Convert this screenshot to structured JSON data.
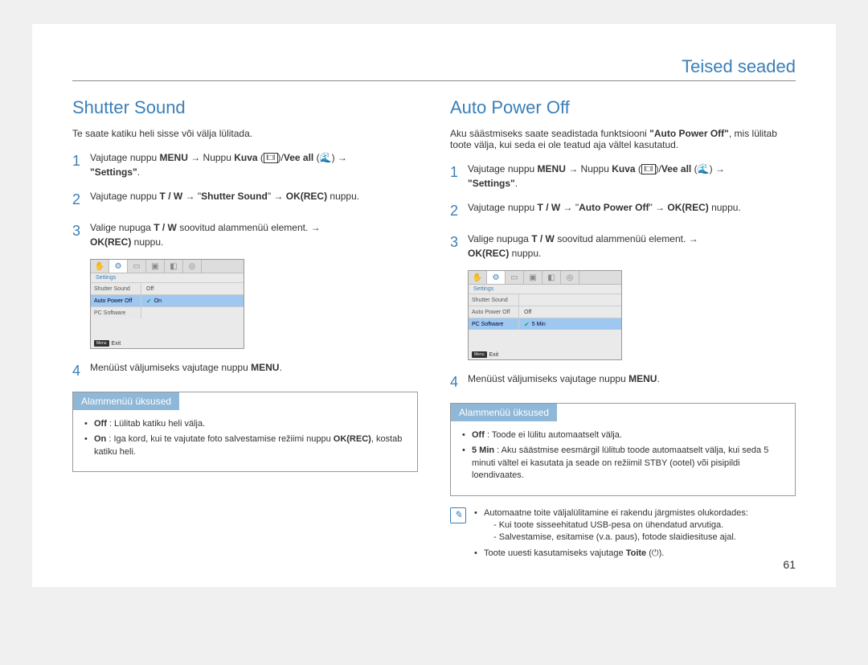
{
  "header": "Teised seaded",
  "page_number": "61",
  "left": {
    "title": "Shutter Sound",
    "intro": "Te saate katiku heli sisse või välja lülitada.",
    "step1_a": "Vajutage nuppu ",
    "step1_menu": "MENU",
    "step1_b": " → Nuppu ",
    "step1_kuva": "Kuva",
    "step1_c": " (",
    "step1_d": ")/",
    "step1_vee": "Vee all",
    "step1_e": " (",
    "step1_f": ") → ",
    "step1_settings": "\"Settings\"",
    "step1_g": ".",
    "step2_a": "Vajutage nuppu ",
    "step2_tw": "T / W",
    "step2_b": " → \"",
    "step2_shutter": "Shutter Sound",
    "step2_c": "\" → ",
    "step2_ok": "OK(REC)",
    "step2_d": " nuppu.",
    "step3_a": "Valige nupuga ",
    "step3_tw": "T / W",
    "step3_b": " soovitud alammenüü element. → ",
    "step3_ok": "OK(REC)",
    "step3_c": " nuppu.",
    "step4_a": "Menüüst väljumiseks vajutage nuppu ",
    "step4_menu": "MENU",
    "step4_b": ".",
    "screen": {
      "settings_label": "Settings",
      "rows": [
        {
          "name": "Shutter Sound",
          "val": "Off",
          "selected": false
        },
        {
          "name": "Auto Power Off",
          "val": "On",
          "selected": true,
          "check": true
        },
        {
          "name": "PC Software",
          "val": "",
          "selected": false
        }
      ],
      "exit": "Exit",
      "menu": "Menu"
    },
    "sub_header": "Alammenüü üksused",
    "sub_off_label": "Off",
    "sub_off_text": " : Lülitab katiku heli välja.",
    "sub_on_label": "On",
    "sub_on_text": " : Iga kord, kui te vajutate foto salvestamise režiimi nuppu ",
    "sub_on_ok": "OK(REC)",
    "sub_on_text2": ", kostab katiku heli."
  },
  "right": {
    "title": "Auto Power Off",
    "intro_a": "Aku säästmiseks saate seadistada funktsiooni ",
    "intro_bold": "\"Auto Power Off\"",
    "intro_b": ", mis lülitab toote välja, kui seda ei ole teatud aja vältel kasutatud.",
    "step1_a": "Vajutage nuppu ",
    "step1_menu": "MENU",
    "step1_b": " → Nuppu ",
    "step1_kuva": "Kuva",
    "step1_c": " (",
    "step1_d": ")/",
    "step1_vee": "Vee all",
    "step1_e": " (",
    "step1_f": ") → ",
    "step1_settings": "\"Settings\"",
    "step1_g": ".",
    "step2_a": "Vajutage nuppu ",
    "step2_tw": "T / W",
    "step2_b": " → \"",
    "step2_apo": "Auto Power Off",
    "step2_c": "\" → ",
    "step2_ok": "OK(REC)",
    "step2_d": " nuppu.",
    "step3_a": "Valige nupuga ",
    "step3_tw": "T / W",
    "step3_b": " soovitud alammenüü element. → ",
    "step3_ok": "OK(REC)",
    "step3_c": " nuppu.",
    "step4_a": "Menüüst väljumiseks vajutage nuppu ",
    "step4_menu": "MENU",
    "step4_b": ".",
    "screen": {
      "settings_label": "Settings",
      "rows": [
        {
          "name": "Shutter Sound",
          "val": "",
          "selected": false
        },
        {
          "name": "Auto Power Off",
          "val": "Off",
          "selected": false
        },
        {
          "name": "PC Software",
          "val": "5 Min",
          "selected": true,
          "check": true
        }
      ],
      "exit": "Exit",
      "menu": "Menu"
    },
    "sub_header": "Alammenüü üksused",
    "sub_off_label": "Off",
    "sub_off_text": " : Toode ei lülitu automaatselt välja.",
    "sub_5min_label": "5 Min",
    "sub_5min_text": " : Aku säästmise eesmärgil lülitub toode automaatselt välja, kui seda 5 minuti vältel ei kasutata ja seade on režiimil STBY (ootel) või pisipildi loendivaates.",
    "note1": "Automaatne toite väljalülitamine ei rakendu järgmistes olukordades:",
    "note1a": "- Kui toote sisseehitatud USB-pesa on ühendatud arvutiga.",
    "note1b": "- Salvestamise, esitamise (v.a. paus), fotode slaidiesituse ajal.",
    "note2_a": "Toote uuesti kasutamiseks vajutage ",
    "note2_b": "Toite",
    "note2_c": " (",
    "note2_d": ")."
  }
}
